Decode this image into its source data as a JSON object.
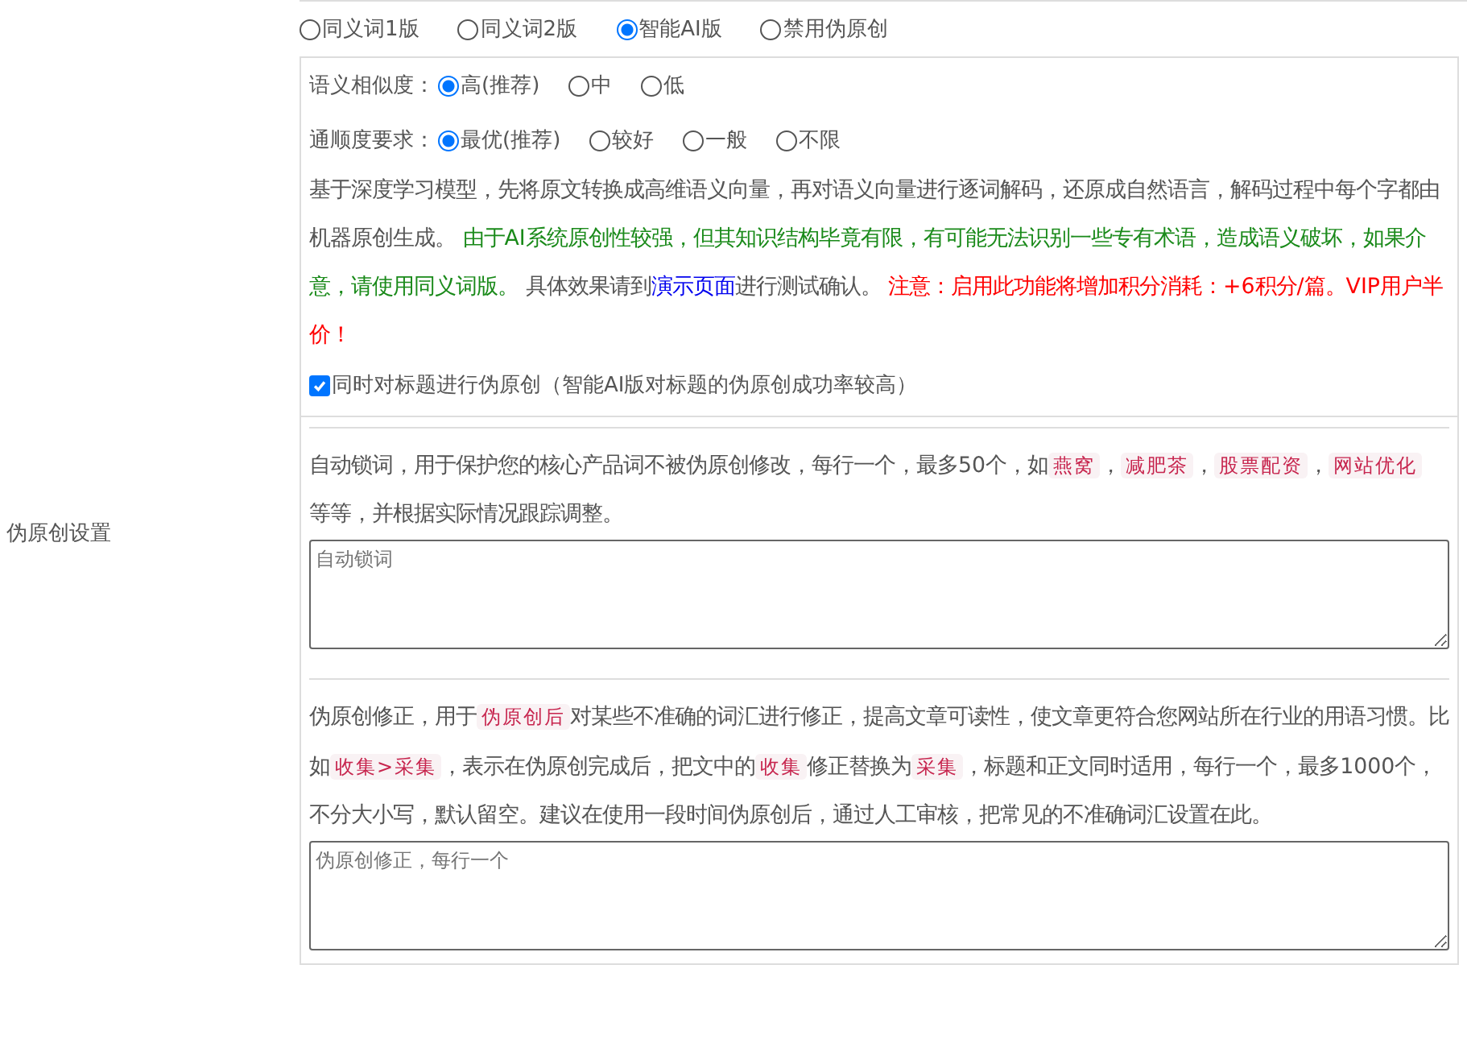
{
  "section_label": "伪原创设置",
  "modes": [
    {
      "label": "同义词1版",
      "selected": false
    },
    {
      "label": "同义词2版",
      "selected": false
    },
    {
      "label": "智能AI版",
      "selected": true
    },
    {
      "label": "禁用伪原创",
      "selected": false
    }
  ],
  "similarity": {
    "label": "语义相似度：",
    "options": [
      {
        "label": "高(推荐)",
        "selected": true
      },
      {
        "label": "中",
        "selected": false
      },
      {
        "label": "低",
        "selected": false
      }
    ]
  },
  "fluency": {
    "label": "通顺度要求：",
    "options": [
      {
        "label": "最优(推荐)",
        "selected": true
      },
      {
        "label": "较好",
        "selected": false
      },
      {
        "label": "一般",
        "selected": false
      },
      {
        "label": "不限",
        "selected": false
      }
    ]
  },
  "ai_description": [
    {
      "kind": "plain",
      "text": "基于深度学习模型，先将原文转换成高维语义向量，再对语义向量进行逐词解码，还原成自然语言，解码过程中每个字都由机器原创生成。 "
    },
    {
      "kind": "notice",
      "text": "由于AI系统原创性较强，但其知识结构毕竟有限，有可能无法识别一些专有术语，造成语义破坏，如果介意，请使用同义词版。"
    },
    {
      "kind": "plain",
      "text": " 具体效果请到"
    },
    {
      "kind": "link",
      "text": "演示页面"
    },
    {
      "kind": "plain",
      "text": "进行测试确认。 "
    },
    {
      "kind": "warning",
      "text": "注意：启用此功能将增加积分消耗：+6积分/篇。VIP用户半价！"
    }
  ],
  "title_option": {
    "label": "同时对标题进行伪原创（智能AI版对标题的伪原创成功率较高）",
    "checked": true
  },
  "lock_words": {
    "description": [
      {
        "kind": "plain",
        "text": "自动锁词，用于保护您的核心产品词不被伪原创修改，每行一个，最多50个，如"
      },
      {
        "kind": "tag",
        "text": "燕窝"
      },
      {
        "kind": "plain",
        "text": "，"
      },
      {
        "kind": "tag",
        "text": "减肥茶"
      },
      {
        "kind": "plain",
        "text": "，"
      },
      {
        "kind": "tag",
        "text": "股票配资"
      },
      {
        "kind": "plain",
        "text": "，"
      },
      {
        "kind": "tag",
        "text": "网站优化"
      },
      {
        "kind": "plain",
        "text": " 等等，并根据实际情况跟踪调整。"
      }
    ],
    "placeholder": "自动锁词"
  },
  "corrections": {
    "description": [
      {
        "kind": "plain",
        "text": "伪原创修正，用于"
      },
      {
        "kind": "tag",
        "text": "伪原创后"
      },
      {
        "kind": "plain",
        "text": "对某些不准确的词汇进行修正，提高文章可读性，使文章更符合您网站所在行业的用语习惯。比如"
      },
      {
        "kind": "tag",
        "text": "收集>采集"
      },
      {
        "kind": "plain",
        "text": "，表示在伪原创完成后，把文中的"
      },
      {
        "kind": "tag",
        "text": "收集"
      },
      {
        "kind": "plain",
        "text": "修正替换为"
      },
      {
        "kind": "tag",
        "text": "采集"
      },
      {
        "kind": "plain",
        "text": "，标题和正文同时适用，每行一个，最多1000个，不分大小写，默认留空。建议在使用一段时间伪原创后，通过人工审核，把常见的不准确词汇设置在此。"
      }
    ],
    "placeholder": "伪原创修正，每行一个"
  }
}
